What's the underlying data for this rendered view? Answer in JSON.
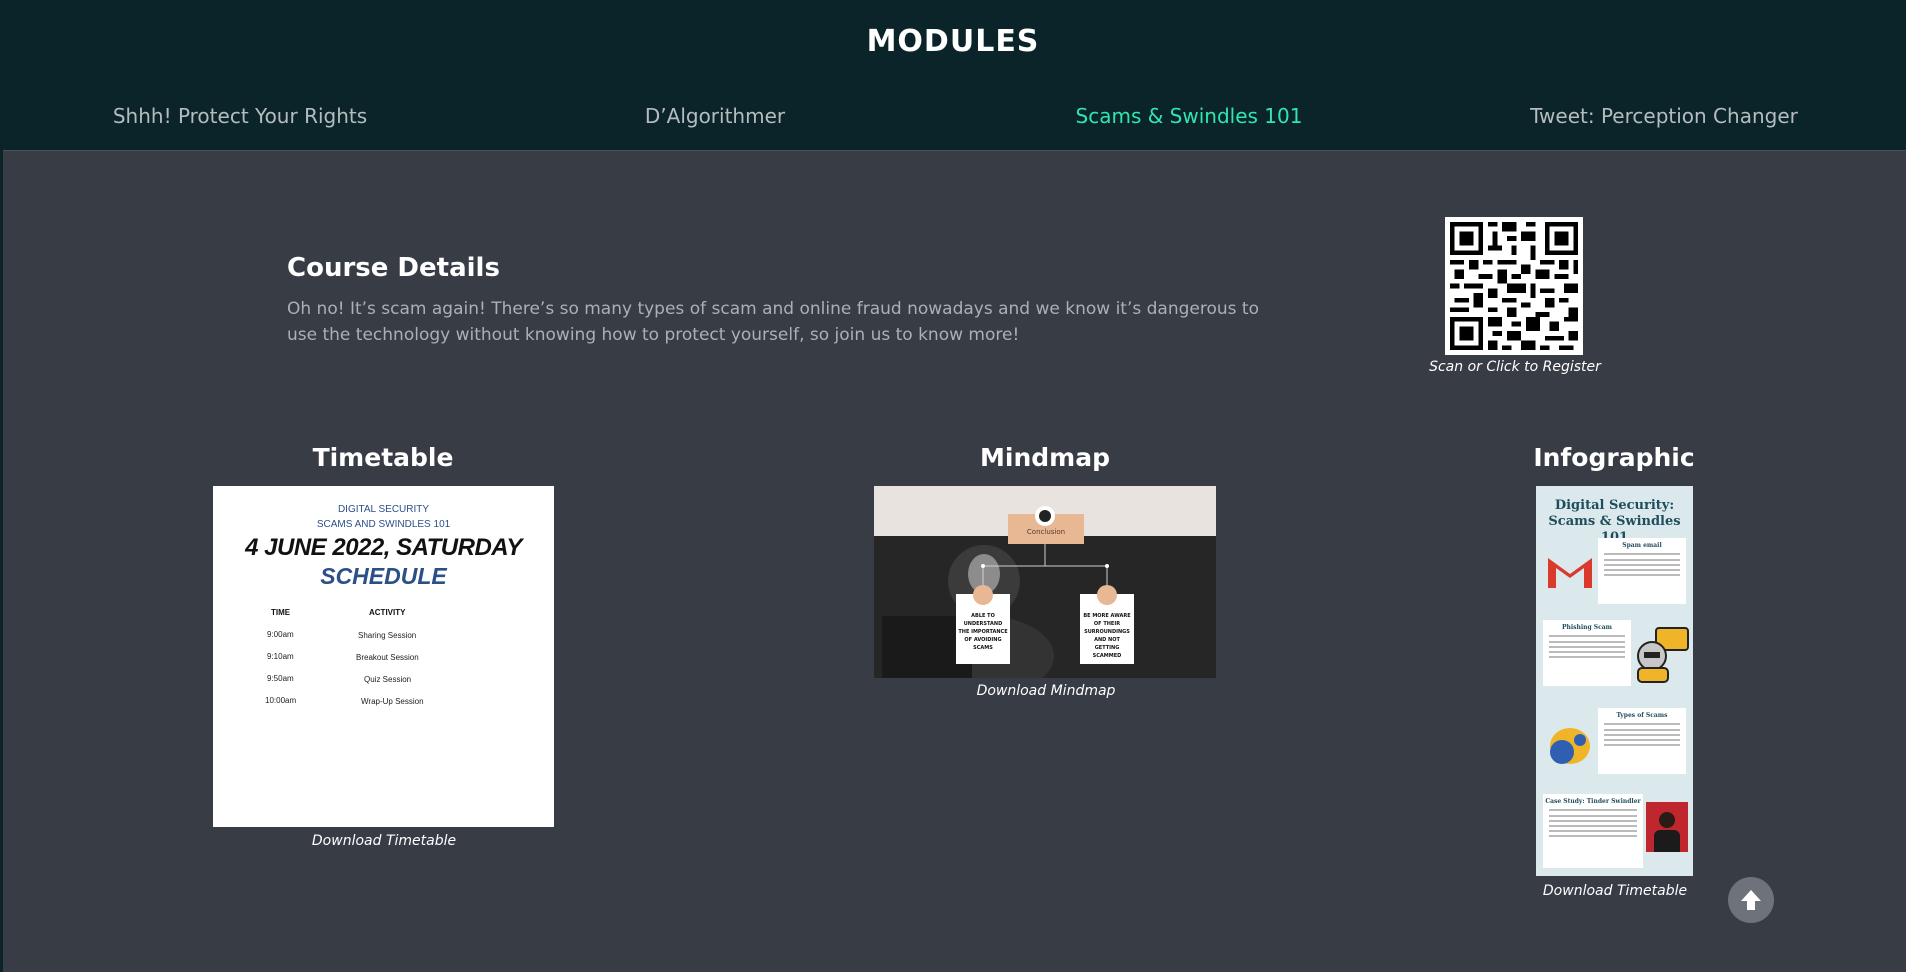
{
  "header": {
    "title": "MODULES",
    "tabs": [
      {
        "label": "Shhh! Protect Your Rights",
        "active": false
      },
      {
        "label": "D’Algorithmer",
        "active": false
      },
      {
        "label": "Scams & Swindles 101",
        "active": true
      },
      {
        "label": "Tweet: Perception Changer",
        "active": false
      }
    ]
  },
  "course": {
    "title": "Course Details",
    "description": "Oh no! It’s scam again! There’s so many types of scam and online fraud nowadays and we know it’s dangerous to use the technology without knowing how to protect yourself, so join us to know more!",
    "qr_caption": "Scan or Click to Register"
  },
  "timetable": {
    "title": "Timetable",
    "caption": "Download Timetable",
    "image": {
      "line1": "DIGITAL SECURITY",
      "line2": "SCAMS AND SWINDLES 101",
      "date": "4 JUNE 2022, SATURDAY",
      "heading": "SCHEDULE",
      "col_time": "TIME",
      "col_activity": "ACTIVITY",
      "rows": [
        {
          "time": "9:00am",
          "activity": "Sharing Session"
        },
        {
          "time": "9:10am",
          "activity": "Breakout Session"
        },
        {
          "time": "9:50am",
          "activity": "Quiz Session"
        },
        {
          "time": "10:00am",
          "activity": "Wrap-Up Session"
        }
      ]
    }
  },
  "mindmap": {
    "title": "Mindmap",
    "caption": "Download Mindmap",
    "image": {
      "center": "Conclusion",
      "left_box": "ABLE TO UNDERSTAND THE IMPORTANCE OF AVOIDING SCAMS",
      "right_box": "BE MORE AWARE OF THEIR SURROUNDINGS AND NOT GETTING SCAMMED"
    }
  },
  "infographic": {
    "title": "Infographic",
    "caption": "Download Timetable",
    "image": {
      "heading": "Digital Security: Scams & Swindles 101",
      "s1": "Spam email",
      "s2": "Phishing Scam",
      "s3": "Types of Scams",
      "s4": "Case Study: Tinder Swindler"
    }
  },
  "colors": {
    "header_bg": "#0b2429",
    "content_bg": "#383c45",
    "active_tab": "#30e6b0",
    "scheme_blue": "#2c4f8a"
  },
  "icons": [
    "qr-code-icon",
    "arrow-up-icon",
    "gmail-icon"
  ]
}
